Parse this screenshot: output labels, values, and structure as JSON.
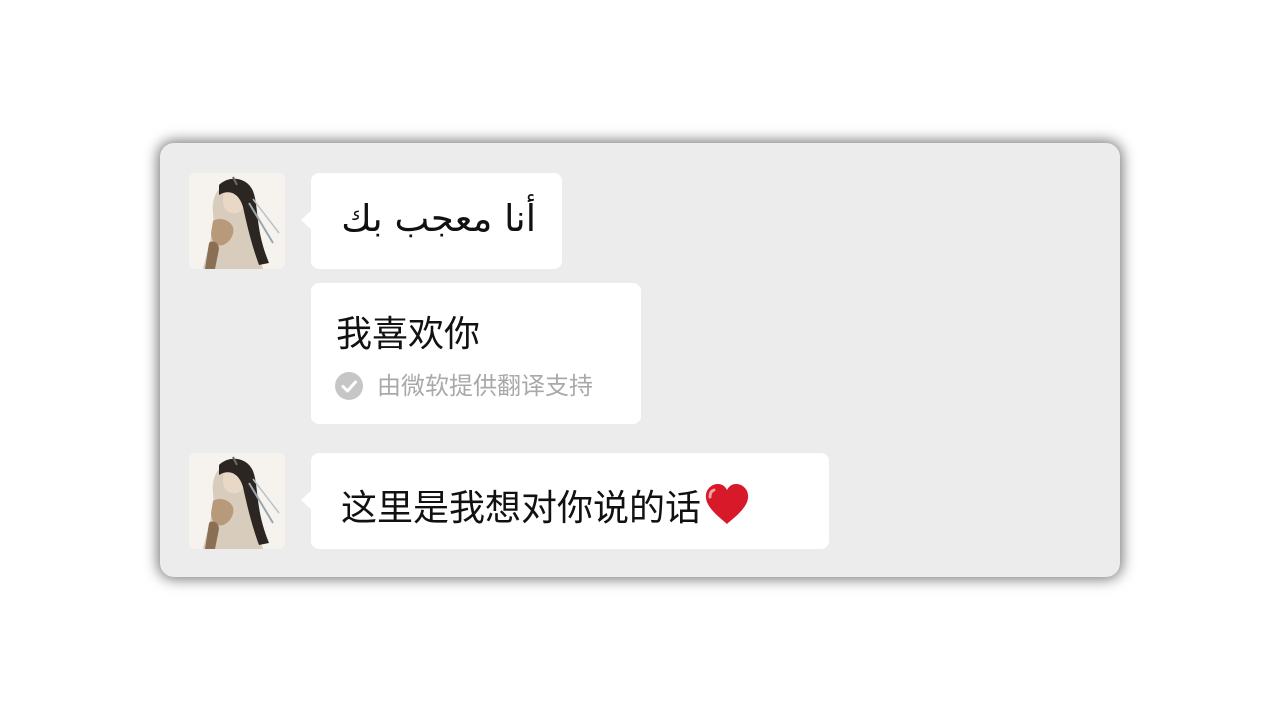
{
  "messages": [
    {
      "sender": "avatar",
      "text": "أنا معجب بك"
    },
    {
      "text": "我喜欢你",
      "translation_note": "由微软提供翻译支持"
    },
    {
      "sender": "avatar",
      "text": "这里是我想对你说的话",
      "emoji": "heart-icon"
    }
  ],
  "colors": {
    "card_background": "#ececec",
    "bubble_background": "#ffffff",
    "heart": "#d7192a",
    "note_text": "#a9a9a9"
  }
}
